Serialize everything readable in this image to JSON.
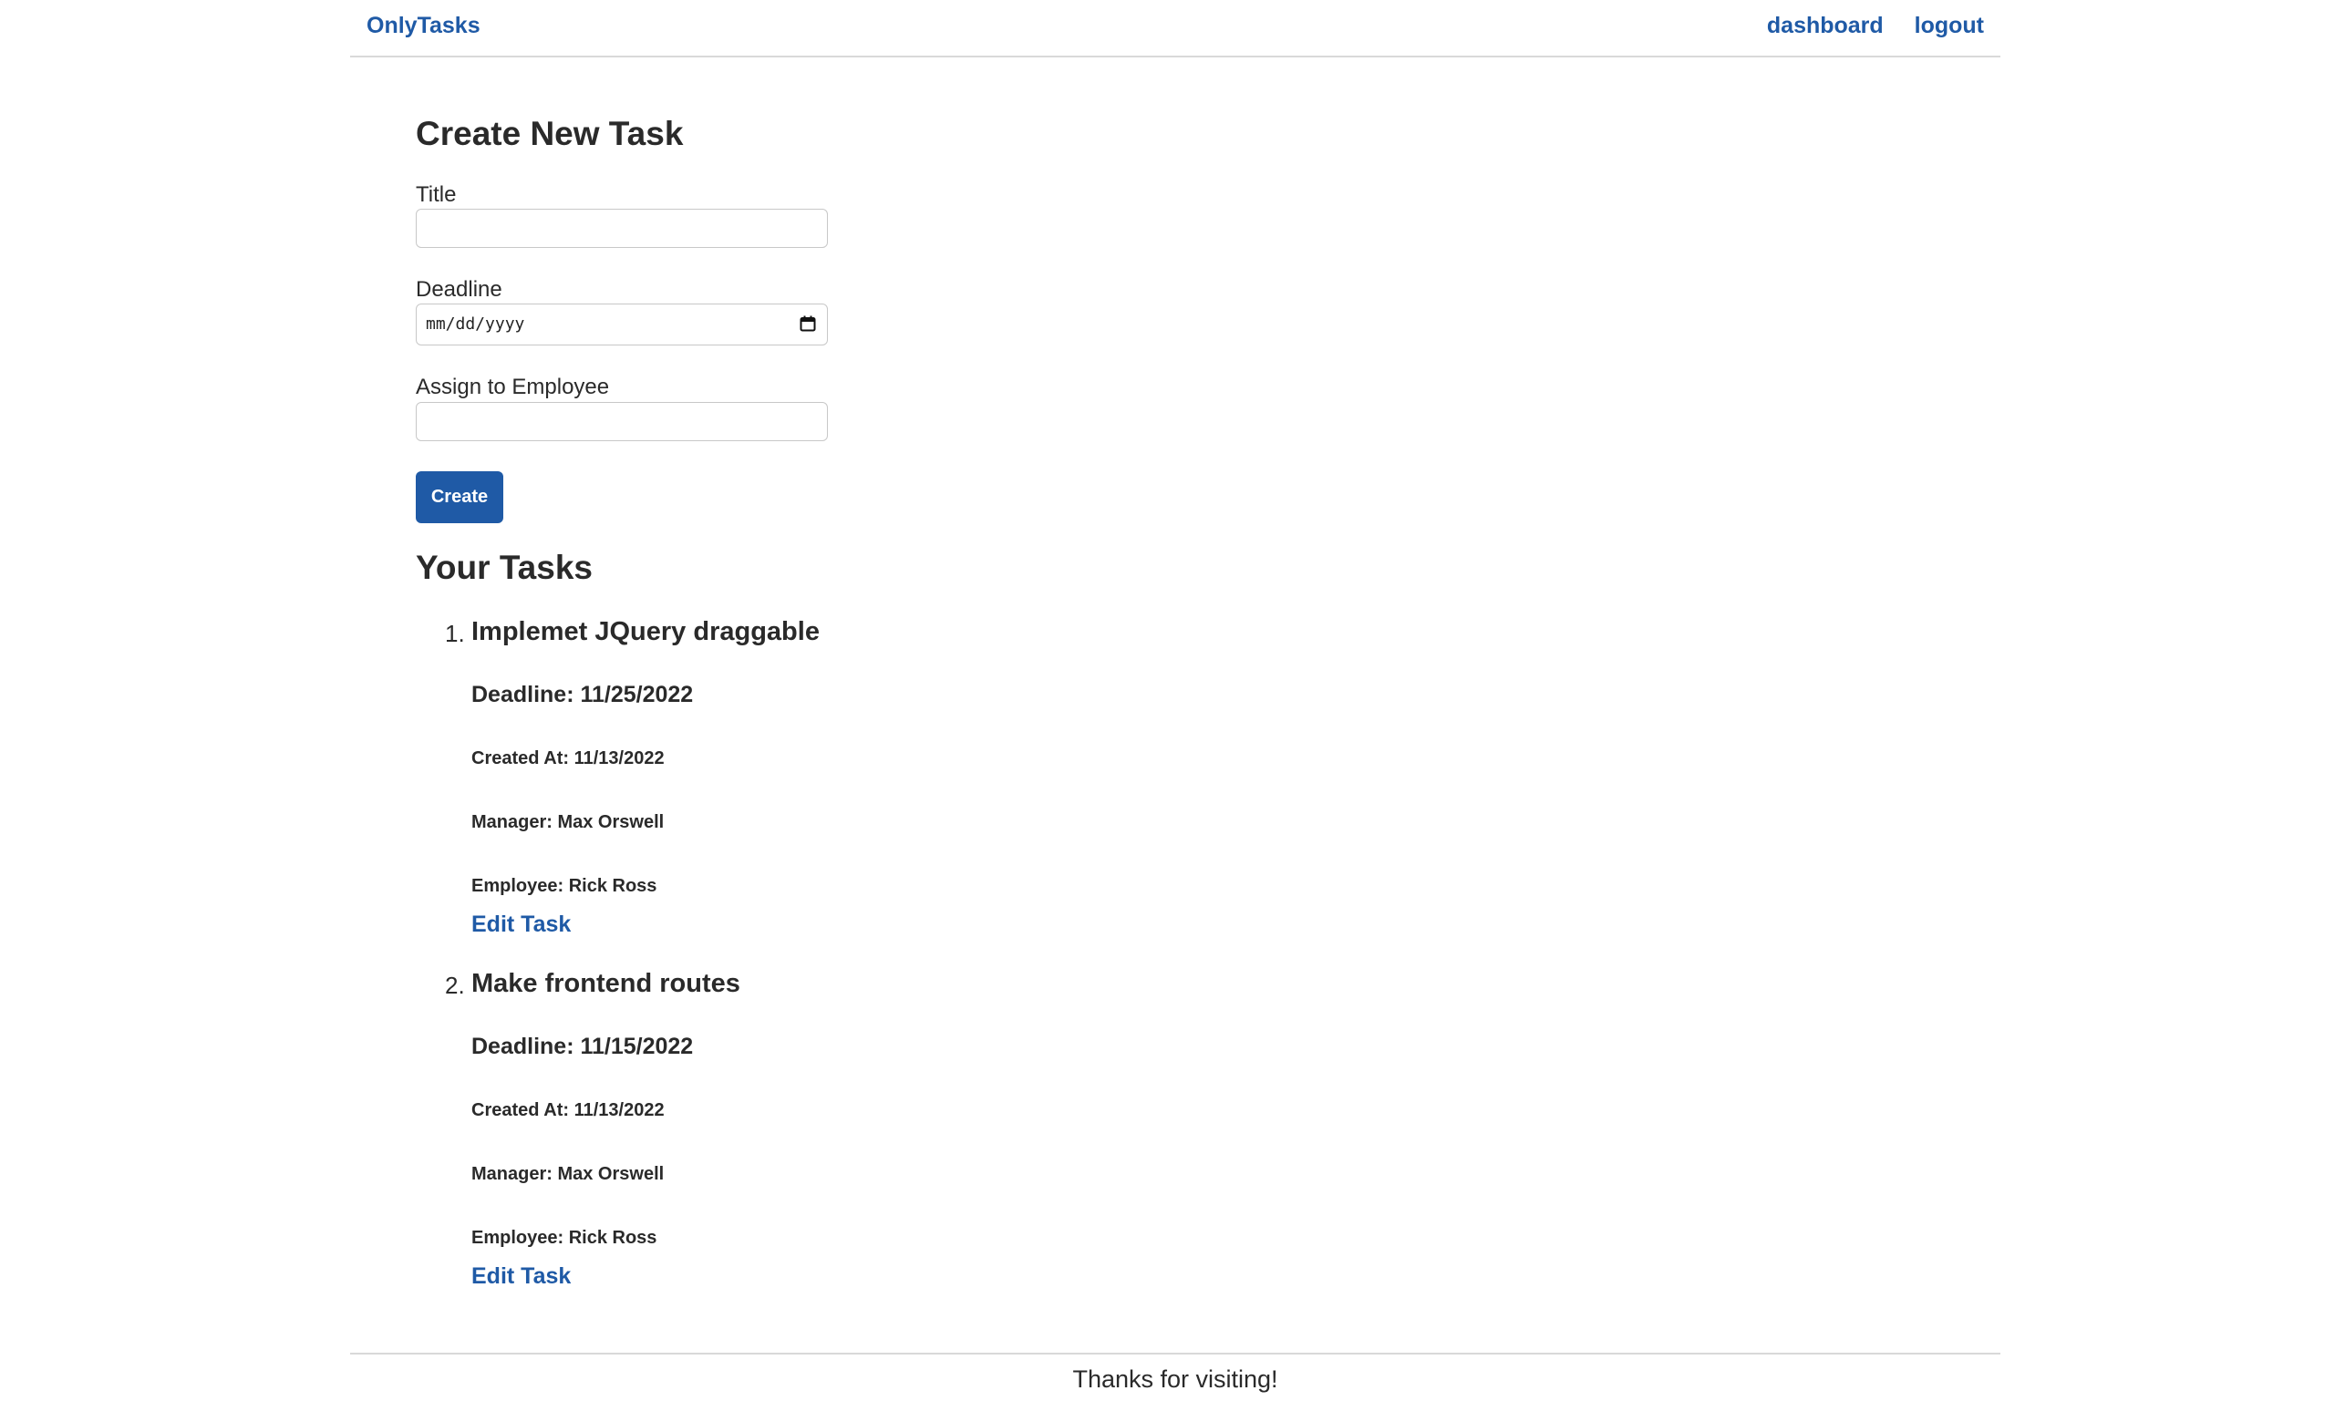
{
  "navbar": {
    "brand": "OnlyTasks",
    "links": [
      "dashboard",
      "logout"
    ]
  },
  "create_form": {
    "heading": "Create New Task",
    "title_label": "Title",
    "title_value": "",
    "deadline_label": "Deadline",
    "deadline_placeholder": "mm/dd/yyyy",
    "assign_label": "Assign to Employee",
    "assign_value": "",
    "submit_label": "Create"
  },
  "tasks_section": {
    "heading": "Your Tasks",
    "tasks": [
      {
        "number": "1.",
        "title": "Implemet JQuery draggable",
        "deadline": "Deadline: 11/25/2022",
        "created": "Created At: 11/13/2022",
        "manager": "Manager: Max Orswell",
        "employee": "Employee: Rick Ross",
        "edit_label": "Edit Task"
      },
      {
        "number": "2.",
        "title": "Make frontend routes",
        "deadline": "Deadline: 11/15/2022",
        "created": "Created At: 11/13/2022",
        "manager": "Manager: Max Orswell",
        "employee": "Employee: Rick Ross",
        "edit_label": "Edit Task"
      }
    ]
  },
  "footer": {
    "text": "Thanks for visiting!"
  },
  "colors": {
    "link": "#1f5aa6",
    "button": "#1f5aa6",
    "text": "#2a2a2a",
    "divider": "#d9d9d9"
  }
}
